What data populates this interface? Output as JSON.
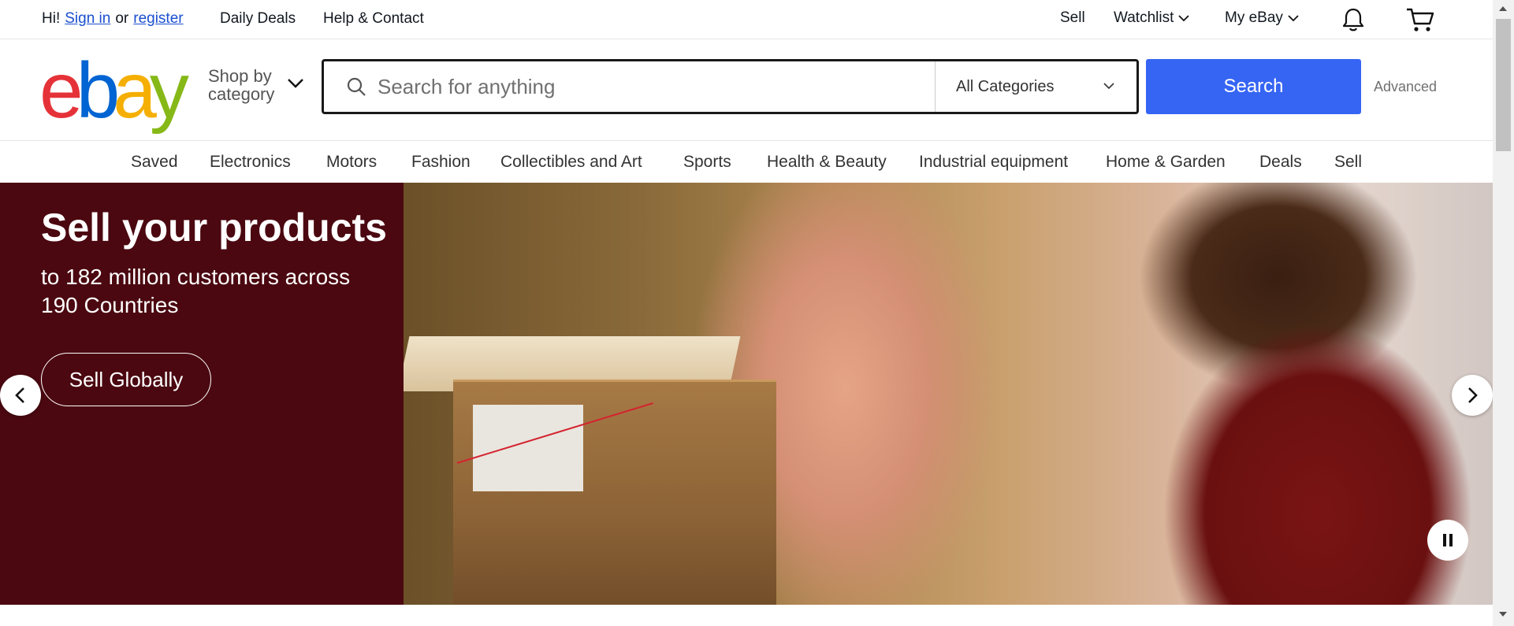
{
  "topbar": {
    "greeting": "Hi!",
    "sign_in": "Sign in",
    "or": "or",
    "register": "register",
    "daily_deals": "Daily Deals",
    "help_contact": "Help & Contact",
    "sell": "Sell",
    "watchlist": "Watchlist",
    "my_ebay": "My eBay",
    "icons": [
      "chevron-down-icon",
      "bell-icon",
      "cart-icon"
    ]
  },
  "header": {
    "logo_letters": [
      {
        "char": "e",
        "color": "#e53238"
      },
      {
        "char": "b",
        "color": "#0064d2"
      },
      {
        "char": "a",
        "color": "#f5af02"
      },
      {
        "char": "y",
        "color": "#86b817"
      }
    ],
    "shop_by_line1": "Shop by",
    "shop_by_line2": "category",
    "search_placeholder": "Search for anything",
    "category_selected": "All Categories",
    "search_button": "Search",
    "advanced": "Advanced",
    "accent_color": "#3665f3"
  },
  "catnav": {
    "items": [
      "Saved",
      "Electronics",
      "Motors",
      "Fashion",
      "Collectibles and Art",
      "Sports",
      "Health & Beauty",
      "Industrial equipment",
      "Home & Garden",
      "Deals",
      "Sell"
    ]
  },
  "hero": {
    "title": "Sell your products",
    "subtitle": "to 182 million customers across 190 Countries",
    "cta": "Sell Globally",
    "panel_color": "#4b0810",
    "icons": [
      "chevron-left-icon",
      "chevron-right-icon",
      "pause-icon"
    ]
  }
}
